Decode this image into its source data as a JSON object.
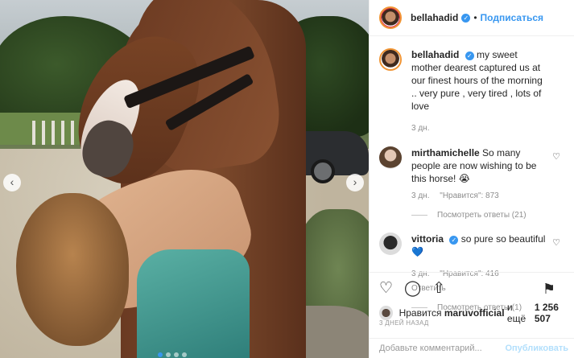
{
  "header": {
    "username": "bellahadid",
    "separator": "•",
    "follow_label": "Подписаться"
  },
  "caption": {
    "username": "bellahadid",
    "text": "my sweet mother dearest captured us at our finest hours of the morning .. very pure , very tired , lots of love",
    "time": "3 дн."
  },
  "comments": [
    {
      "username": "mirthamichelle",
      "text": "So many people are now wishing to be this horse! 😭",
      "time": "3 дн.",
      "likes": "\"Нравится\": 873",
      "replies_label": "Посмотреть ответы (21)"
    },
    {
      "username": "vittoria",
      "text": "so pure so beautiful 💙",
      "time": "3 дн.",
      "likes": "\"Нравится\": 416",
      "reply_label": "Ответить",
      "replies_label": "Посмотреть ответы (1)"
    }
  ],
  "likes": {
    "prefix": "Нравится",
    "user": "maruvofficial",
    "middle": "и ещё",
    "count": "1 256 507"
  },
  "date_label": "3 ДНЕЙ НАЗАД",
  "add_comment": {
    "placeholder": "Добавьте комментарий...",
    "publish_label": "Опубликовать"
  },
  "icons": {
    "prev": "‹",
    "next": "›",
    "heart": "♡",
    "comment": "◯",
    "share": "⇧",
    "save": "⚑",
    "verified": "✓"
  },
  "carousel": {
    "slides": 4,
    "active_index": 0
  },
  "colors": {
    "accent": "#3897f0",
    "publish_disabled": "#b2dffc"
  }
}
